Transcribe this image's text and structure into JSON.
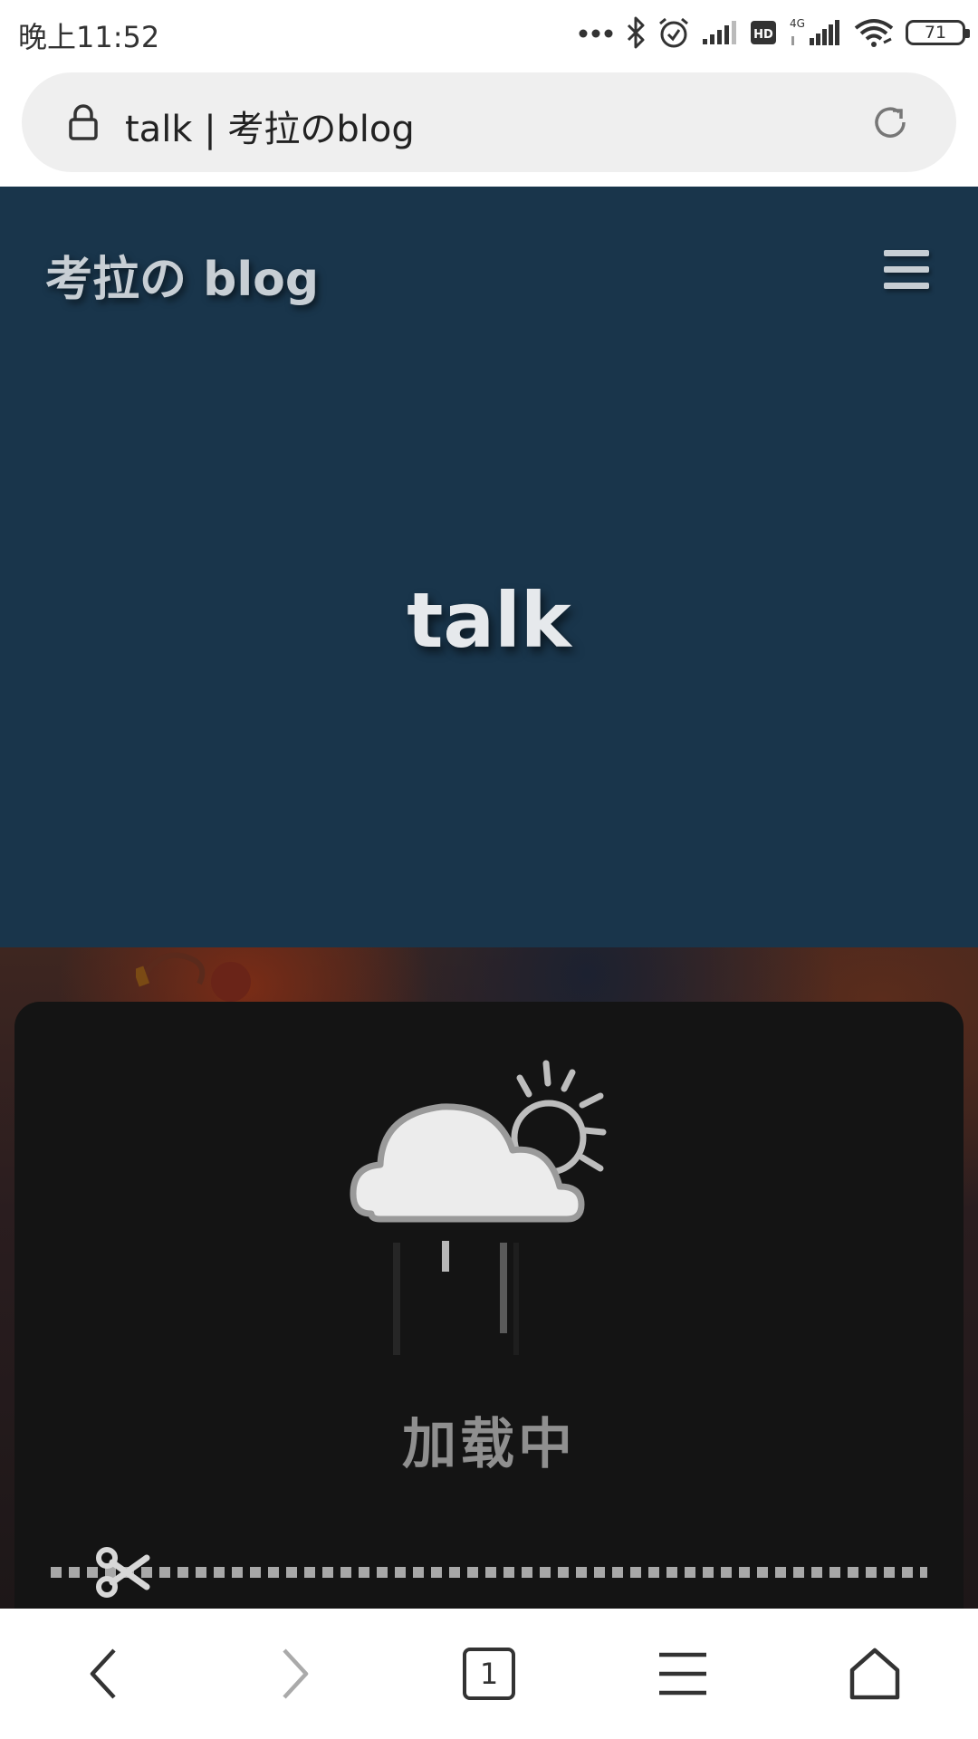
{
  "status_bar": {
    "time": "晚上11:52",
    "battery_level": "71",
    "icons": [
      "more-dots-icon",
      "bluetooth-icon",
      "alarm-icon",
      "signal-icon",
      "hd-icon",
      "4g-signal-icon",
      "wifi-icon",
      "battery-icon"
    ],
    "hd_label": "HD",
    "network_label": "4G"
  },
  "browser": {
    "url_title": "talk | 考拉のblog",
    "lock_icon": "lock-icon",
    "reload_icon": "reload-icon"
  },
  "site": {
    "title": "考拉の blog",
    "menu_icon": "hamburger-menu-icon",
    "page_heading": "talk",
    "header_color": "#19354b"
  },
  "loader": {
    "icon": "cloud-sun-rain-icon",
    "label": "加载中",
    "cut_icon": "scissors-icon",
    "card_color": "#141414"
  },
  "bottom_nav": {
    "items": [
      {
        "name": "back",
        "icon": "chevron-left-icon"
      },
      {
        "name": "forward",
        "icon": "chevron-right-icon"
      },
      {
        "name": "tabs",
        "icon": "tabs-icon",
        "count": "1"
      },
      {
        "name": "menu",
        "icon": "hamburger-menu-icon"
      },
      {
        "name": "home",
        "icon": "home-icon"
      }
    ]
  }
}
